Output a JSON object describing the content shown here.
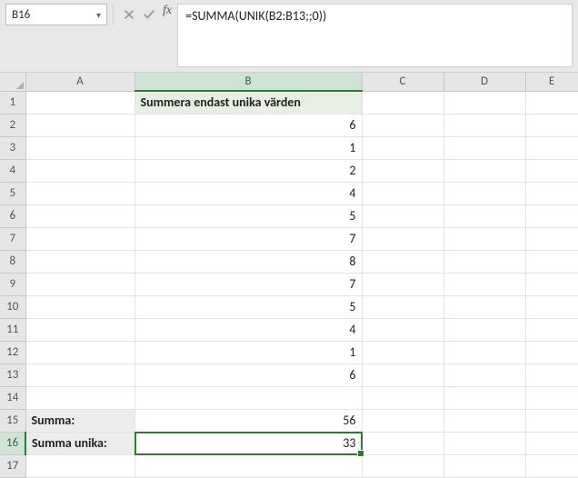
{
  "namebox": {
    "value": "B16"
  },
  "formula_bar": {
    "formula": "=SUMMA(UNIK(B2:B13;;0))"
  },
  "columns": {
    "A": "A",
    "B": "B",
    "C": "C",
    "D": "D",
    "E": "E"
  },
  "rows": {
    "r1": "1",
    "r2": "2",
    "r3": "3",
    "r4": "4",
    "r5": "5",
    "r6": "6",
    "r7": "7",
    "r8": "8",
    "r9": "9",
    "r10": "10",
    "r11": "11",
    "r12": "12",
    "r13": "13",
    "r14": "14",
    "r15": "15",
    "r16": "16",
    "r17": "17"
  },
  "cells": {
    "B1": "Summera endast unika värden",
    "B2": "6",
    "B3": "1",
    "B4": "2",
    "B5": "4",
    "B6": "5",
    "B7": "7",
    "B8": "8",
    "B9": "7",
    "B10": "5",
    "B11": "4",
    "B12": "1",
    "B13": "6",
    "A15": "Summa:",
    "B15": "56",
    "A16": "Summa unika:",
    "B16": "33"
  },
  "chart_data": {
    "type": "table",
    "title": "Summera endast unika värden",
    "values": [
      6,
      1,
      2,
      4,
      5,
      7,
      8,
      7,
      5,
      4,
      1,
      6
    ],
    "summary": {
      "Summa": 56,
      "Summa unika": 33
    }
  }
}
